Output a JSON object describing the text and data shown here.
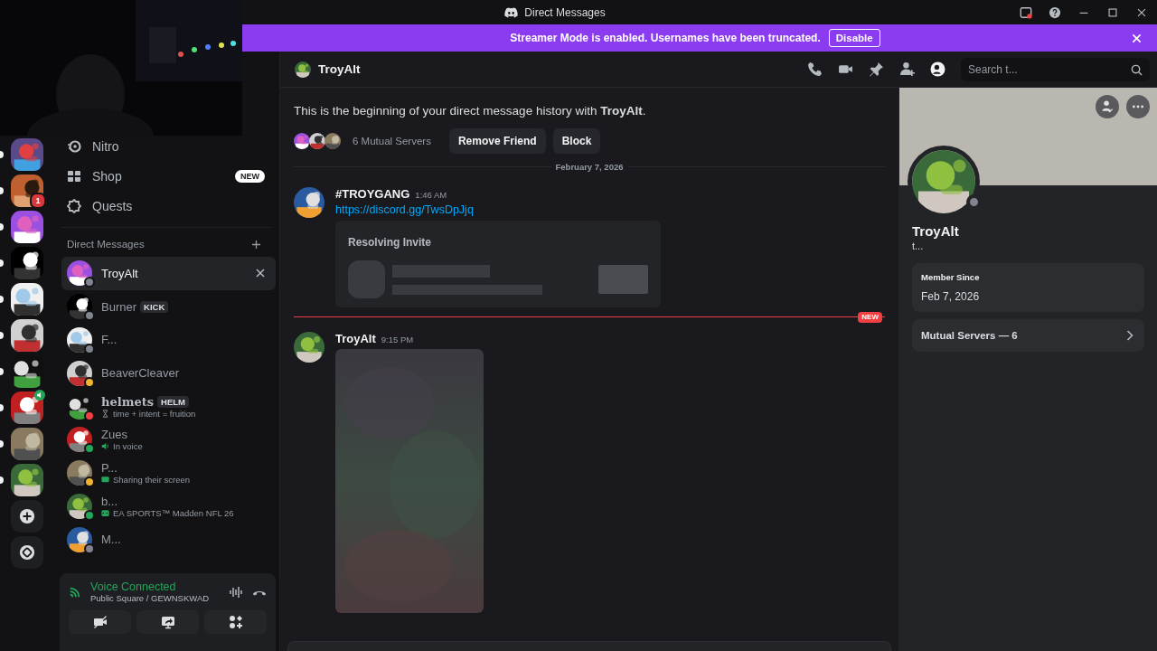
{
  "window": {
    "title": "Direct Messages"
  },
  "banner": {
    "text": "Streamer Mode is enabled. Usernames have been truncated.",
    "button": "Disable"
  },
  "servers": [
    {
      "kind": "picture",
      "unread": true
    },
    {
      "kind": "picture",
      "unread": true,
      "badge": "1"
    },
    {
      "kind": "picture",
      "unread": true
    },
    {
      "kind": "picture",
      "unread": true
    },
    {
      "kind": "picture",
      "unread": true
    },
    {
      "kind": "picture",
      "unread": true
    },
    {
      "kind": "picture",
      "unread": true
    },
    {
      "kind": "picture",
      "unread": true,
      "voice": true
    },
    {
      "kind": "picture",
      "unread": true
    },
    {
      "kind": "picture",
      "unread": true
    },
    {
      "kind": "add"
    },
    {
      "kind": "discover"
    }
  ],
  "nav": [
    {
      "label": "Nitro"
    },
    {
      "label": "Shop",
      "badge": "NEW"
    },
    {
      "label": "Quests"
    }
  ],
  "dm_header": "Direct Messages",
  "dms": [
    {
      "name": "TroyAlt",
      "color": "#80848e",
      "selected": true
    },
    {
      "name": "Burner",
      "tag": "KICK",
      "color": "#80848e",
      "selected": false
    },
    {
      "name": "F...",
      "color": "#80848e",
      "selected": false
    },
    {
      "name": "BeaverCleaver",
      "color": "#f0b232",
      "selected": false
    },
    {
      "name": "helmets",
      "tag": "HELM",
      "activity": {
        "kind": "custom",
        "text": "time + intent = fruition"
      },
      "color": "#f23f43",
      "selected": false
    },
    {
      "name": "Zues",
      "activity": {
        "kind": "voice",
        "text": "In voice"
      },
      "color": "#23a55a",
      "selected": false
    },
    {
      "name": "P...",
      "activity": {
        "kind": "screen",
        "text": "Sharing their screen"
      },
      "color": "#f0b232",
      "selected": false
    },
    {
      "name": "b...",
      "activity": {
        "kind": "game",
        "text": "EA SPORTS™ Madden NFL 26"
      },
      "color": "#23a55a",
      "selected": false
    },
    {
      "name": "M...",
      "color": "#80848e",
      "selected": false
    }
  ],
  "voice": {
    "title": "Voice Connected",
    "subtitle": "Public Square / GEWNSKWAD"
  },
  "chat": {
    "recipient": "TroyAlt",
    "search_placeholder": "Search t...",
    "intro": "This is the beginning of your direct message history with **TroyAlt**.",
    "mutual": "6 Mutual Servers",
    "actions": [
      "Remove Friend",
      "Block"
    ],
    "date": "February 7, 2026",
    "messages": [
      {
        "author": "#TROYGANG",
        "time": "1:46 AM",
        "link": "https://discord.gg/TwsDpJjq",
        "embed": {
          "title": "Resolving Invite"
        }
      },
      {
        "author": "TroyAlt",
        "time": "9:15 PM",
        "divider": {
          "label": "NEW"
        },
        "attachment": {
          "kind": "picture"
        }
      }
    ]
  },
  "profile": {
    "name": "TroyAlt",
    "subtitle": "t...",
    "color": "#80848e",
    "member_since_label": "Member Since",
    "member_since": "Feb 7, 2026",
    "mutual": "Mutual Servers — 6"
  }
}
